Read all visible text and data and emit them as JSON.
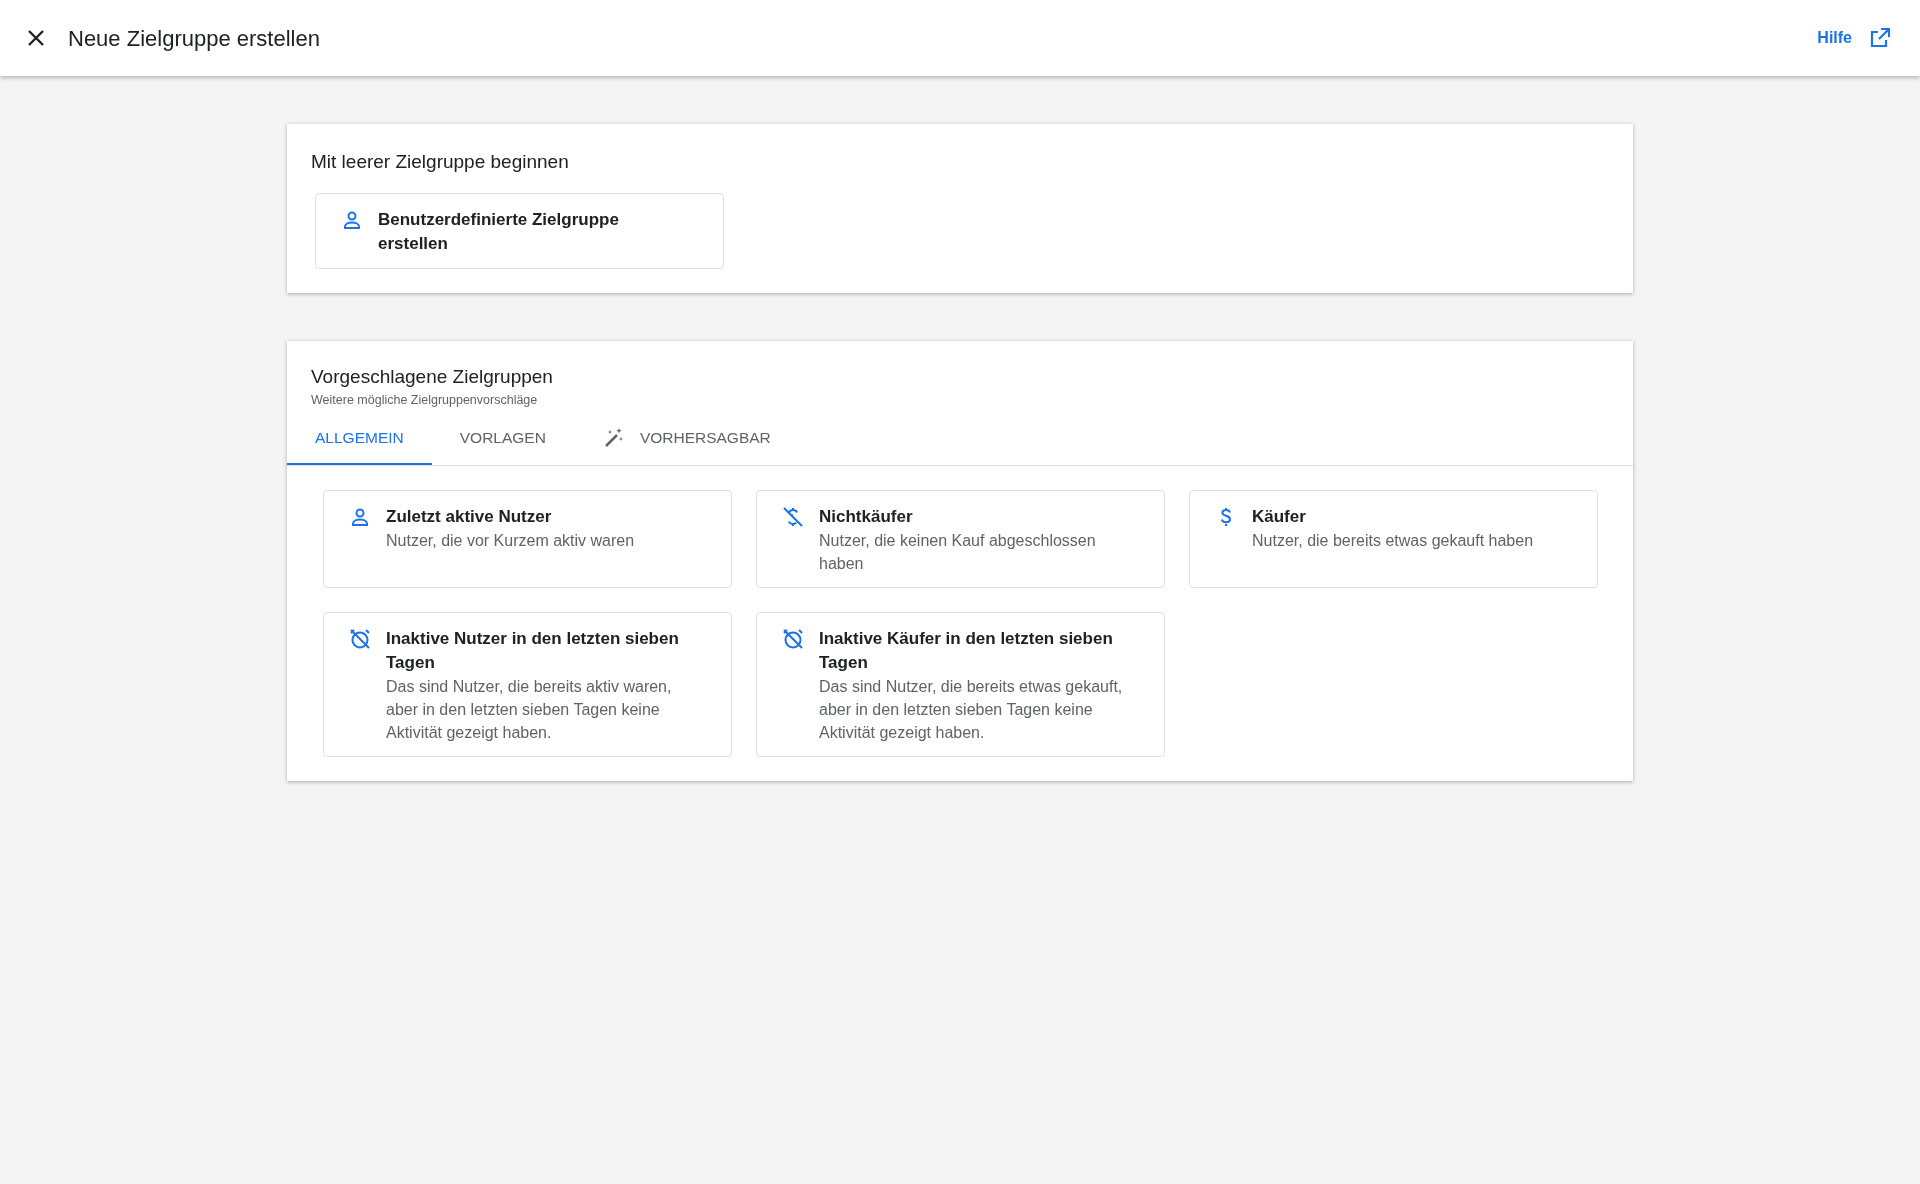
{
  "header": {
    "title": "Neue Zielgruppe erstellen",
    "help_link": "Hilfe"
  },
  "blank_section": {
    "title": "Mit leerer Zielgruppe beginnen",
    "options": [
      {
        "kind": "person",
        "title": "Benutzerdefinierte Zielgruppe erstellen"
      }
    ]
  },
  "suggested_section": {
    "title": "Vorgeschlagene Zielgruppen",
    "subtitle": "Weitere mögliche Zielgruppenvorschläge",
    "tabs": [
      {
        "label": "ALLGEMEIN",
        "selected": true
      },
      {
        "label": "VORLAGEN",
        "selected": false
      },
      {
        "label": "VORHERSAGBAR",
        "selected": false,
        "kind": "wand"
      }
    ],
    "options": [
      {
        "kind": "person",
        "title": "Zuletzt aktive Nutzer",
        "description": "Nutzer, die vor Kurzem aktiv waren"
      },
      {
        "kind": "money-off",
        "title": "Nichtkäufer",
        "description": "Nutzer, die keinen Kauf abgeschlossen haben"
      },
      {
        "kind": "dollar",
        "title": "Käufer",
        "description": "Nutzer, die bereits etwas gekauft haben"
      },
      {
        "kind": "alarm-off",
        "title": "Inaktive Nutzer in den letzten sieben Tagen",
        "description": "Das sind Nutzer, die bereits aktiv waren, aber in den letzten sieben Tagen keine Aktivität gezeigt haben."
      },
      {
        "kind": "alarm-off",
        "title": "Inaktive Käufer in den letzten sieben Tagen",
        "description": "Das sind Nutzer, die bereits etwas gekauft, aber in den letzten sieben Tagen keine Aktivität gezeigt haben."
      }
    ]
  }
}
